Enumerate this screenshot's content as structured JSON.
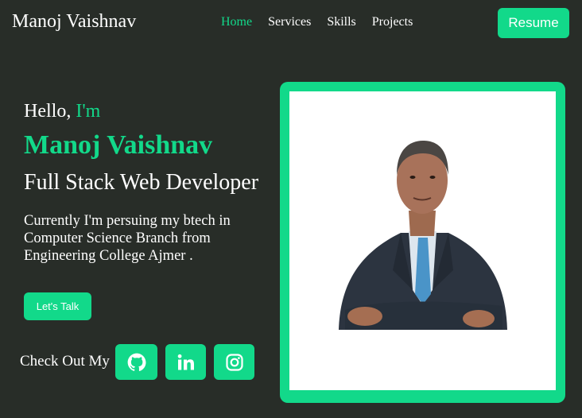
{
  "nav": {
    "brand": "Manoj Vaishnav",
    "links": [
      "Home",
      "Services",
      "Skills",
      "Projects"
    ],
    "resume_label": "Resume"
  },
  "hero": {
    "greeting": "Hello, ",
    "greeting_highlight": "I'm",
    "name": "Manoj Vaishnav",
    "role": "Full Stack Web Developer",
    "bio": "Currently I'm persuing my btech in Computer Science Branch from Engineering College Ajmer .",
    "cta_label": "Let's Talk",
    "social_heading": "Check Out My",
    "social_icons": [
      "github-icon",
      "linkedin-icon",
      "instagram-icon"
    ]
  },
  "colors": {
    "background": "#282d28",
    "accent": "#12d98a",
    "text": "#ffffff"
  }
}
